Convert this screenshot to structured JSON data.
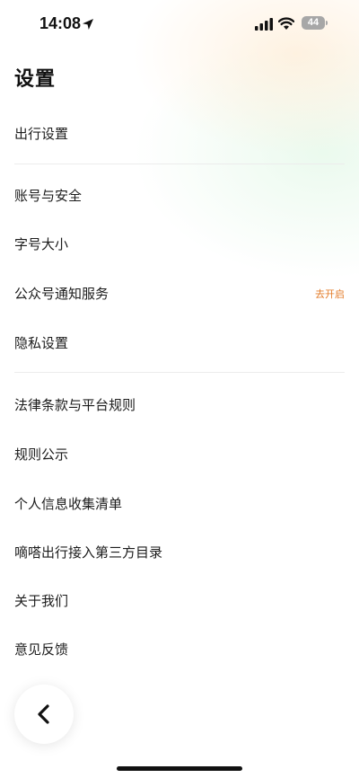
{
  "status_bar": {
    "time": "14:08",
    "battery": "44"
  },
  "page": {
    "title": "设置"
  },
  "menu": {
    "travel_settings": "出行设置",
    "account_security": "账号与安全",
    "font_size": "字号大小",
    "public_account_notification": "公众号通知服务",
    "public_account_notification_action": "去开启",
    "privacy_settings": "隐私设置",
    "legal_terms": "法律条款与平台规则",
    "rules_announcement": "规则公示",
    "personal_info_list": "个人信息收集清单",
    "third_party_directory": "嘀嗒出行接入第三方目录",
    "about_us": "关于我们",
    "feedback": "意见反馈"
  },
  "colors": {
    "accent": "#e37c2a",
    "divider": "#ececec"
  }
}
